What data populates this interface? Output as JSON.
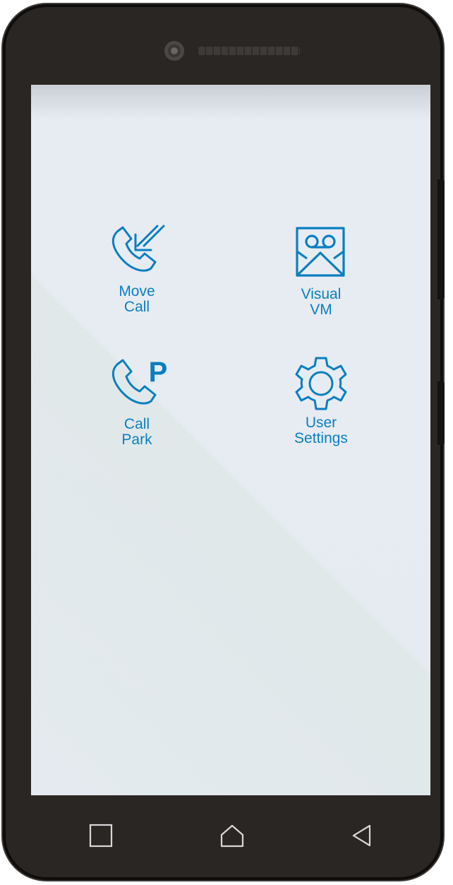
{
  "apps": [
    {
      "id": "move-call",
      "label": "Move\nCall",
      "icon": "move-call-icon"
    },
    {
      "id": "visual-vm",
      "label": "Visual\nVM",
      "icon": "voicemail-envelope-icon"
    },
    {
      "id": "call-park",
      "label": "Call\nPark",
      "icon": "call-park-icon"
    },
    {
      "id": "user-settings",
      "label": "User\nSettings",
      "icon": "gear-icon"
    }
  ],
  "navbar": {
    "recents": "recents-square-icon",
    "home": "home-icon",
    "back": "back-triangle-icon"
  },
  "colors": {
    "accent": "#0a7fc0",
    "bezel": "#2a2624",
    "screen": "#e6ecf2"
  }
}
